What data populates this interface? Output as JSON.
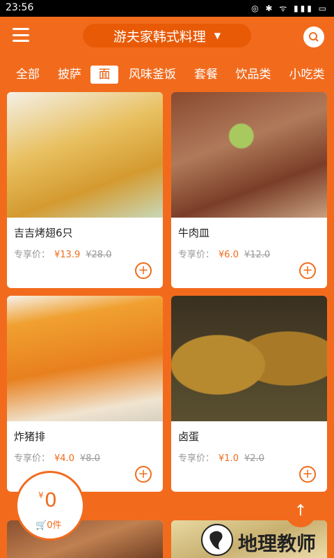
{
  "status": {
    "time": "23:56"
  },
  "header": {
    "store_name": "游夫家韩式料理"
  },
  "tabs": [
    {
      "label": "全部"
    },
    {
      "label": "披萨"
    },
    {
      "label": "面",
      "active": true
    },
    {
      "label": "风味釜饭"
    },
    {
      "label": "套餐"
    },
    {
      "label": "饮品类"
    },
    {
      "label": "小吃类"
    }
  ],
  "price_label": "专享价：",
  "items": [
    {
      "name": "吉吉烤翅6只",
      "price": "¥13.9",
      "orig": "¥28.0"
    },
    {
      "name": "牛肉皿",
      "price": "¥6.0",
      "orig": "¥12.0"
    },
    {
      "name": "炸猪排",
      "price": "¥4.0",
      "orig": "¥8.0"
    },
    {
      "name": "卤蛋",
      "price": "¥1.0",
      "orig": "¥2.0"
    }
  ],
  "cart": {
    "currency": "¥",
    "total": "0",
    "count": "0件"
  },
  "watermark": {
    "text": "地理教师"
  },
  "colors": {
    "accent": "#f26b1d",
    "accent_dark": "#e85a06"
  }
}
